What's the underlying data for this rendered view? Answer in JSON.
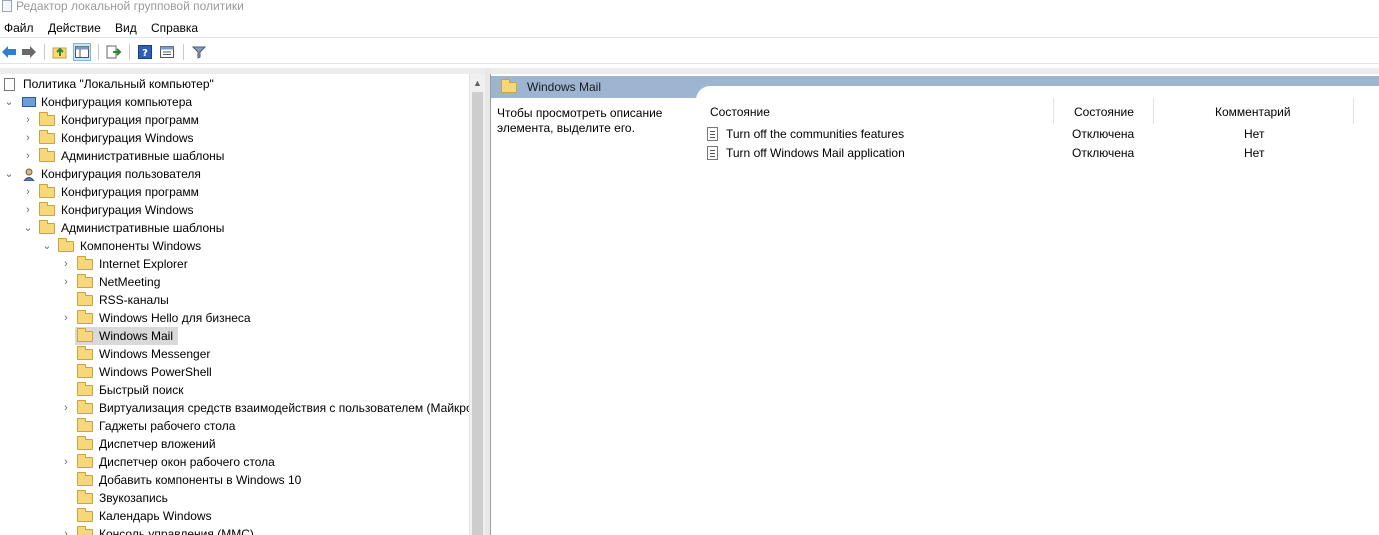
{
  "window": {
    "title": "Редактор локальной групповой политики"
  },
  "menu": [
    "Файл",
    "Действие",
    "Вид",
    "Справка"
  ],
  "toolbar": {
    "icons": [
      "back-icon",
      "forward-icon",
      "up-folder-icon",
      "show-hide-tree-icon",
      "export-list-icon",
      "help-icon",
      "properties-icon",
      "filter-icon"
    ]
  },
  "tree": {
    "root": "Политика \"Локальный компьютер\"",
    "items": [
      {
        "label": "Конфигурация компьютера"
      },
      {
        "label": "Конфигурация программ"
      },
      {
        "label": "Конфигурация Windows"
      },
      {
        "label": "Административные шаблоны"
      },
      {
        "label": "Конфигурация пользователя"
      },
      {
        "label": "Конфигурация программ"
      },
      {
        "label": "Конфигурация Windows"
      },
      {
        "label": "Административные шаблоны"
      },
      {
        "label": "Компоненты Windows"
      },
      {
        "label": "Internet Explorer"
      },
      {
        "label": "NetMeeting"
      },
      {
        "label": "RSS-каналы"
      },
      {
        "label": "Windows Hello для бизнеса"
      },
      {
        "label": "Windows Mail"
      },
      {
        "label": "Windows Messenger"
      },
      {
        "label": "Windows PowerShell"
      },
      {
        "label": "Быстрый поиск"
      },
      {
        "label": "Виртуализация средств взаимодействия с пользователем (Майкро"
      },
      {
        "label": "Гаджеты рабочего стола"
      },
      {
        "label": "Диспетчер вложений"
      },
      {
        "label": "Диспетчер окон рабочего стола"
      },
      {
        "label": "Добавить компоненты в Windows 10"
      },
      {
        "label": "Звукозапись"
      },
      {
        "label": "Календарь Windows"
      },
      {
        "label": "Консоль управления (MMC)"
      }
    ],
    "selected": "Windows Mail"
  },
  "details": {
    "title": "Windows Mail",
    "description": "Чтобы просмотреть описание элемента, выделите его.",
    "columns": [
      "Состояние",
      "Состояние",
      "Комментарий"
    ],
    "rows": [
      {
        "name": "Turn off the communities features",
        "state": "Отключена",
        "comment": "Нет"
      },
      {
        "name": "Turn off Windows Mail application",
        "state": "Отключена",
        "comment": "Нет"
      }
    ]
  }
}
